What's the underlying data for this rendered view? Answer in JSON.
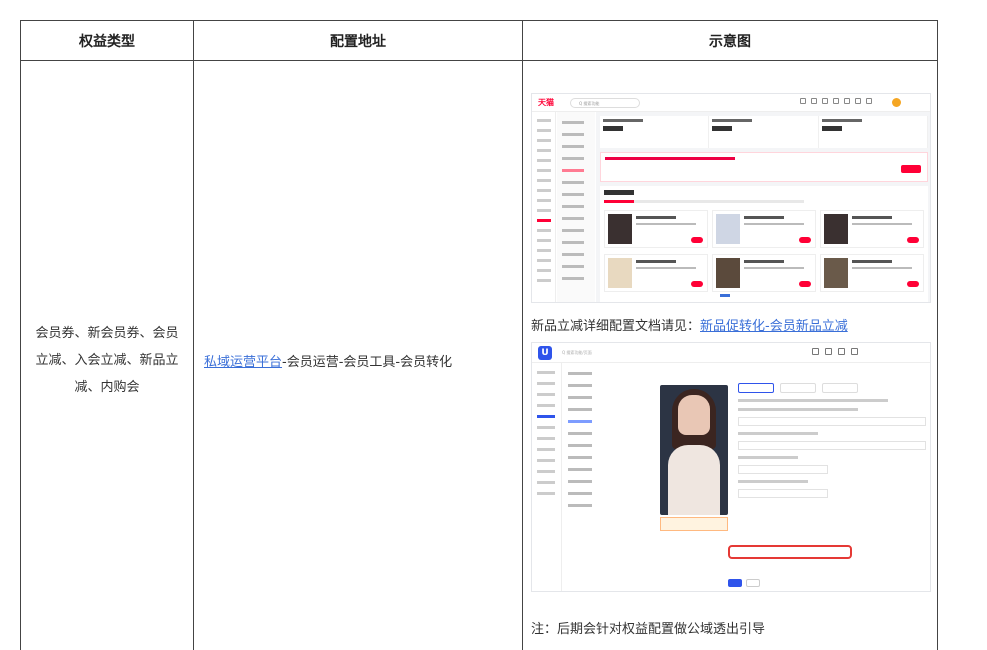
{
  "table": {
    "headers": [
      "权益类型",
      "配置地址",
      "示意图"
    ],
    "row": {
      "benefit_type": "会员券、新会员券、会员立减、入会立减、新品立减、内购会",
      "config_address": {
        "link_text": "私域运营平台",
        "path_text": "-会员运营-会员工具-会员转化"
      },
      "doc_note": {
        "prefix": "新品立减详细配置文档请见：",
        "link_text": "新品促转化-会员新品立减"
      },
      "footer_note": "注：后期会针对权益配置做公域透出引导"
    }
  },
  "screenshot1": {
    "logo": "天猫",
    "search_placeholder": "Q 搜索功能",
    "section_title": "会员工具",
    "brand_color": "#ff0036"
  },
  "screenshot2": {
    "logo": "U",
    "search_placeholder": "Q 搜索功能/页面",
    "brand_color": "#2f54eb",
    "highlight_color": "#e53935"
  },
  "colors": {
    "link": "#3a6fd8",
    "border": "#444444"
  }
}
